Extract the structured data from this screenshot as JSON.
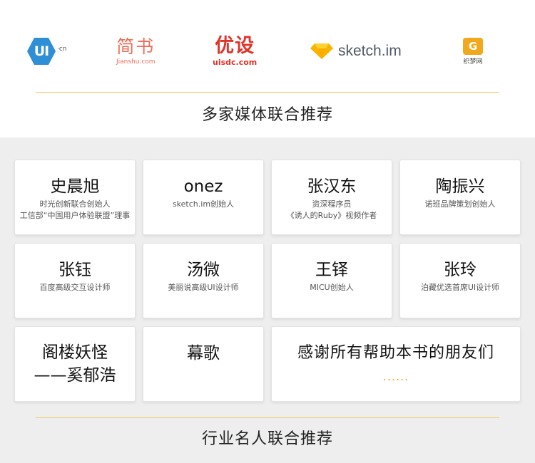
{
  "logos": {
    "ui_cn": {
      "mark": "UI",
      "suffix": "·cn"
    },
    "jianshu": {
      "name": "简书",
      "domain": "Jianshu.com",
      "color": "#ea6f5a"
    },
    "uisdc": {
      "name": "优设",
      "domain": "uisdc.com",
      "color": "#e0342b"
    },
    "sketch": {
      "name": "sketch.im",
      "icon": "diamond-icon",
      "color": "#f7b500"
    },
    "zhimeng": {
      "mark": "G",
      "name": "织梦网",
      "color": "#f2a81d"
    }
  },
  "media_section": {
    "title": "多家媒体联合推荐"
  },
  "cards": [
    {
      "name": "史晨旭",
      "desc": [
        "时光创新联合创始人",
        "工信部“中国用户体验联盟”理事"
      ]
    },
    {
      "name": "onez",
      "desc": [
        "sketch.im创始人"
      ]
    },
    {
      "name": "张汉东",
      "desc": [
        "资深程序员",
        "《诱人的Ruby》视频作者"
      ]
    },
    {
      "name": "陶振兴",
      "desc": [
        "诺班品牌策划创始人"
      ]
    },
    {
      "name": "张钰",
      "desc": [
        "百度高级交互设计师"
      ]
    },
    {
      "name": "汤微",
      "desc": [
        "美丽说高级UI设计师"
      ]
    },
    {
      "name": "王铎",
      "desc": [
        "MICU创始人"
      ]
    },
    {
      "name": "张玲",
      "desc": [
        "泊藏优选首席UI设计师"
      ]
    },
    {
      "name_line1": "阁楼妖怪",
      "name_line2": "——奚郁浩"
    },
    {
      "name": "幕歌"
    },
    {
      "thanks": "感谢所有帮助本书的朋友们",
      "dots": "......"
    }
  ],
  "industry_section": {
    "title": "行业名人联合推荐"
  },
  "colors": {
    "accent": "#f3c766",
    "card_bg": "#ffffff",
    "panel_bg": "#eeeeee"
  }
}
